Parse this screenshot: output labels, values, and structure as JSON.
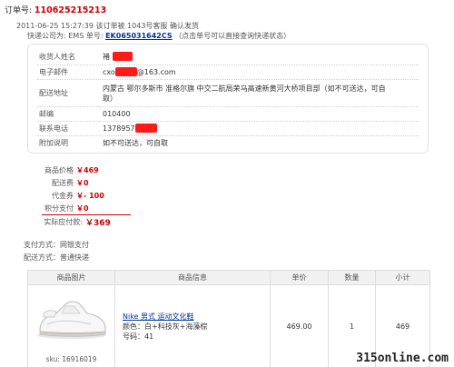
{
  "order": {
    "label": "订单号:",
    "number": "110625215213"
  },
  "status_line": "2011-06-25 15:27:39 该订单被 1043号客服 确认发货",
  "shipping": {
    "company_label": "快递公司为:",
    "company": "EMS",
    "no_label": "单号:",
    "tracking": "EK065031642CS",
    "hint": "（点击单号可以直接查询快递状态）"
  },
  "recipient": {
    "name_label": "收货人姓名",
    "name_value": "褚",
    "email_label": "电子邮件",
    "email_prefix": "cxo",
    "email_suffix": "@163.com",
    "address_label": "配送地址",
    "address_value": "内蒙古 鄂尔多斯市 准格尔旗 中交二航局荣乌高速新黄河大桥项目部（如不可送达，可自取）",
    "zip_label": "邮编",
    "zip_value": "010400",
    "phone_label": "联系电话",
    "phone_value": "1378957",
    "note_label": "附加说明",
    "note_value": "如不可送达，可自取"
  },
  "prices": {
    "goods_label": "商品价格",
    "goods_value": "￥469",
    "ship_label": "配送费",
    "ship_value": "￥0",
    "coupon_label": "代金券",
    "coupon_value": "￥- 100",
    "points_label": "积分支付",
    "points_value": "￥0",
    "total_label": "实际应付款:",
    "total_value": "￥369"
  },
  "payment": {
    "pay_text": "支付方式：网银支付",
    "delivery_text": "配送方式：普通快递"
  },
  "table": {
    "headers": [
      "商品图片",
      "商品信息",
      "单价",
      "数量",
      "小计"
    ],
    "item": {
      "sku": "sku: 16916019",
      "name": "Nike 男式 运动文化鞋",
      "color": "颜色：白+科技灰+海藻棕",
      "size": "号码：41",
      "price": "469.00",
      "qty": "1",
      "subtotal": "469"
    }
  },
  "watermark": "315online.com",
  "colors": {
    "accent_red": "#cc0000",
    "link_blue": "#003399",
    "redaction": "#ff1a1a"
  }
}
